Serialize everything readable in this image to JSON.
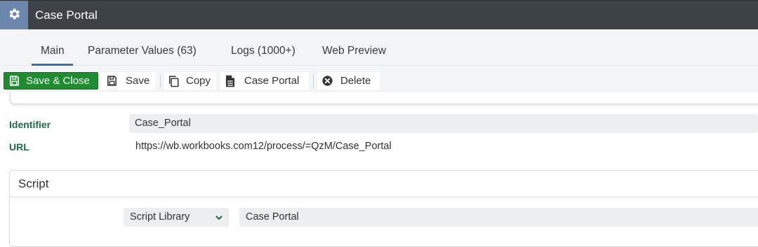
{
  "window": {
    "title": "Case Portal"
  },
  "icons": {
    "settings": "gear-icon",
    "save_close": "floppy-disk-icon",
    "save": "floppy-disk-icon",
    "copy": "copy-icon",
    "case_portal": "document-icon",
    "delete": "circle-x-icon",
    "select": "chevron-down-icon"
  },
  "colors": {
    "titlebar": "#3d4247",
    "gear_box": "#6c86ad",
    "primary_button": "#1e8c2f",
    "label_green": "#1f6b46",
    "tab_underline": "#3f6fa6"
  },
  "tabs": [
    {
      "label": "Main",
      "active": true
    },
    {
      "label": "Parameter Values (63)",
      "active": false
    },
    {
      "label": "Logs (1000+)",
      "active": false
    },
    {
      "label": "Web Preview",
      "active": false
    }
  ],
  "toolbar": {
    "save_close": "Save & Close",
    "save": "Save",
    "copy": "Copy",
    "case_portal": "Case Portal",
    "delete": "Delete"
  },
  "fields": {
    "identifier": {
      "label": "Identifier",
      "value": "Case_Portal"
    },
    "url": {
      "label": "URL",
      "value": "https://wb.workbooks.com12/process/=QzM/Case_Portal"
    }
  },
  "script": {
    "title": "Script",
    "type_selected": "Script Library",
    "value": "Case Portal"
  }
}
